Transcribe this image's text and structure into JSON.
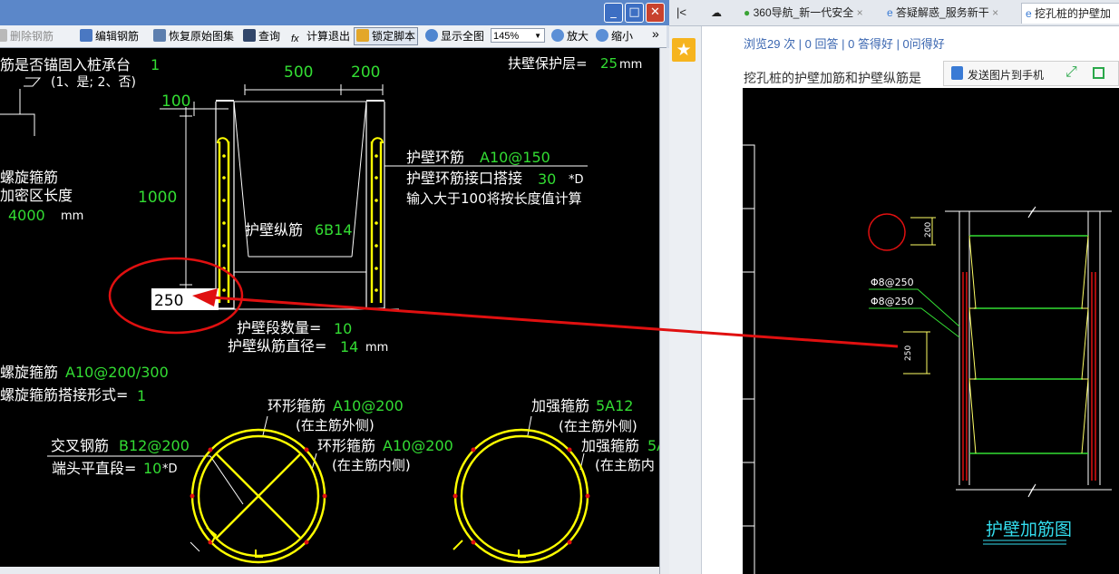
{
  "cad": {
    "window_buttons": {
      "min": "_",
      "max": "□",
      "close": "✕"
    },
    "toolbar": {
      "delete_rebar": "删除钢筋",
      "edit_rebar": "编辑钢筋",
      "restore_original": "恢复原始图集",
      "query": "查询",
      "calc_exit": "计算退出",
      "lock_script": "锁定脚本",
      "show_full": "显示全图",
      "zoom_value": "145%",
      "zoom_in": "放大",
      "zoom_out": "缩小",
      "more": "»"
    },
    "drawing": {
      "anchor_q_label": "筋是否锚固入桩承台",
      "anchor_q_value": "1",
      "anchor_q_options": "(1、是; 2、否)",
      "cover_label": "扶壁保护层=",
      "cover_value": "25",
      "cover_unit": "mm",
      "dim_500": "500",
      "dim_200": "200",
      "dim_100": "100",
      "dim_1000": "1000",
      "dim_250": "250",
      "spiral_label1": "螺旋箍筋",
      "spiral_label2": "加密区长度",
      "spiral_len_value": "4000",
      "spiral_len_unit": "mm",
      "ring_label": "护壁环筋",
      "ring_value": "A10@150",
      "ring_lap_label": "护壁环筋接口搭接",
      "ring_lap_value": "30",
      "ring_lap_unit": "*D",
      "ring_lap_note": "输入大于100将按长度值计算",
      "long_label": "护壁纵筋",
      "long_value": "6B14",
      "seg_count_label": "护壁段数量=",
      "seg_count_value": "10",
      "long_dia_label": "护壁纵筋直径=",
      "long_dia_value": "14",
      "long_dia_unit": "mm",
      "spiral_stirrup_label": "螺旋箍筋",
      "spiral_stirrup_value": "A10@200/300",
      "spiral_lap_label": "螺旋箍筋搭接形式=",
      "spiral_lap_value": "1",
      "ring_out_label": "环形箍筋",
      "ring_out_value": "A10@200",
      "ring_out_note": "(在主筋外侧)",
      "ring_in_label": "环形箍筋",
      "ring_in_value": "A10@200",
      "ring_in_note": "(在主筋内侧)",
      "cross_label": "交叉钢筋",
      "cross_value": "B12@200",
      "end_label": "端头平直段=",
      "end_value": "10",
      "end_unit": "*D",
      "strength_label": "加强箍筋",
      "strength_value": "5A12",
      "strength_note": "(在主筋外侧)",
      "strength2_label": "加强箍筋",
      "strength2_value": "5A",
      "strength2_note": "(在主筋内"
    }
  },
  "browser": {
    "nav_back": "|<",
    "tabs": [
      "360导航_新一代安全",
      "答疑解惑_服务新干",
      "挖孔桩的护壁加"
    ],
    "tab_close": "×",
    "stats": "浏览29 次 | 0 回答 | 0 答得好 | 0问得好",
    "question_title": "挖孔桩的护壁加筋和护壁纵筋是",
    "send_to_phone": "发送图片到手机",
    "photo": {
      "label_a": "Φ8@250",
      "label_b": "Φ8@250",
      "dim_200": "200",
      "dim_250": "250",
      "caption": "护壁加筋图"
    }
  },
  "colors": {
    "cad_bg": "#000000",
    "cad_green": "#33dd33",
    "cad_yellow": "#ffff00",
    "cad_white": "#ffffff",
    "annot_red": "#e01010",
    "link_blue": "#3b67b1"
  }
}
